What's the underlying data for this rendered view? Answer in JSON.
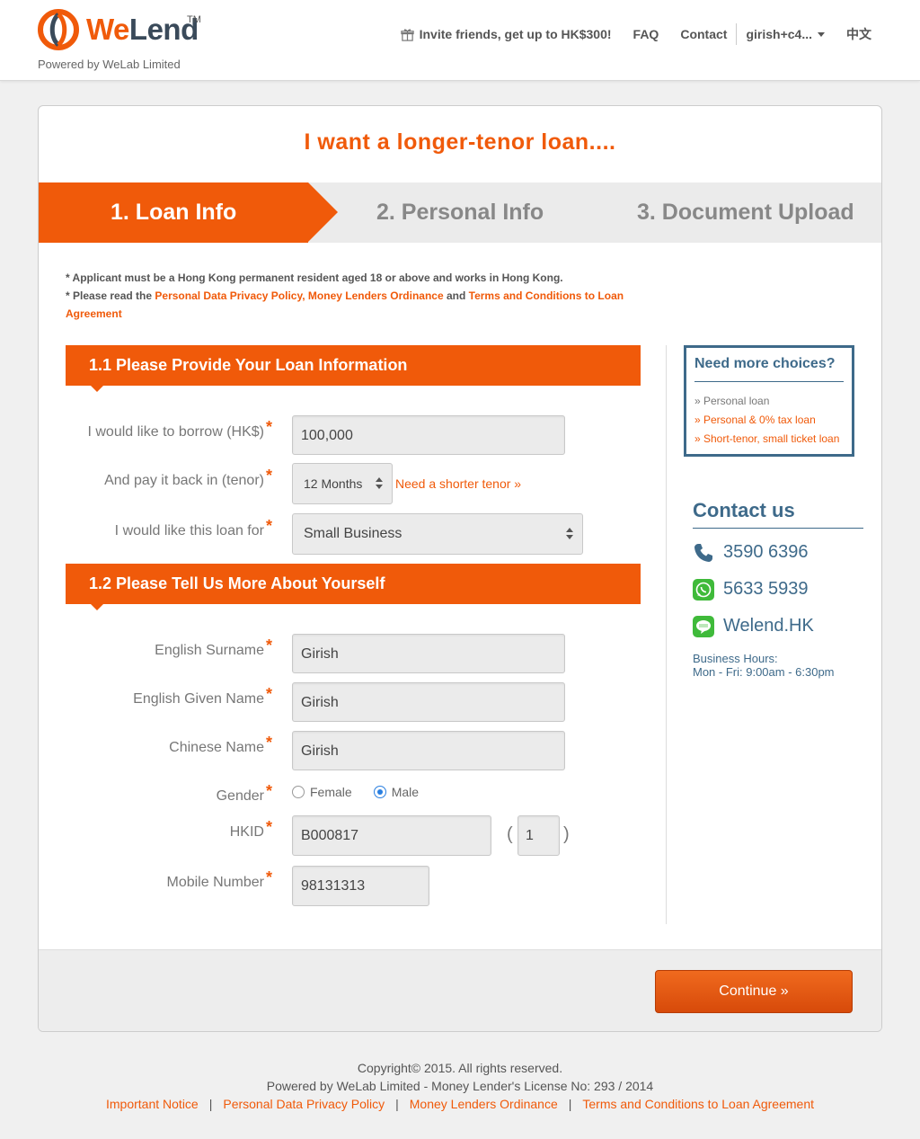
{
  "header": {
    "logo": {
      "brand_we": "We",
      "brand_lend": "Lend",
      "tm": "TM",
      "powered": "Powered by WeLab Limited"
    },
    "nav": {
      "invite": "Invite friends, get up to HK$300!",
      "faq": "FAQ",
      "contact": "Contact",
      "user": "girish+c4...",
      "language": "中文"
    }
  },
  "page": {
    "title": "I want a longer-tenor loan....",
    "steps": [
      "1. Loan Info",
      "2. Personal Info",
      "3. Document Upload"
    ],
    "notes": {
      "line1": "* Applicant must be a Hong Kong permanent resident aged 18 or above and works in Hong Kong.",
      "line2_prefix": "* Please read the ",
      "privacy_link": "Personal Data Privacy Policy, Money Lenders Ordinance",
      "and": " and ",
      "terms_link": "Terms and Conditions to Loan Agreement"
    }
  },
  "section1": {
    "title": "1.1 Please Provide Your Loan Information",
    "borrow_label": "I would like to borrow (HK$)",
    "borrow_value": "100,000",
    "tenor_label": "And pay it back in (tenor)",
    "tenor_value": "12 Months",
    "shorter_link": "Need a shorter tenor »",
    "purpose_label": "I would like this loan for",
    "purpose_value": "Small Business"
  },
  "section2": {
    "title": "1.2 Please Tell Us More About Yourself",
    "surname_label": "English Surname",
    "surname_value": "Girish",
    "given_label": "English Given Name",
    "given_value": "Girish",
    "chinese_label": "Chinese Name",
    "chinese_value": "Girish",
    "gender_label": "Gender",
    "gender_options": [
      "Female",
      "Male"
    ],
    "gender_selected": "Male",
    "hkid_label": "HKID",
    "hkid_value": "B000817",
    "hkid_check": "1",
    "paren_open": "(",
    "paren_close": ")",
    "mobile_label": "Mobile Number",
    "mobile_value": "98131313",
    "required_mark": "*"
  },
  "sidebar": {
    "choices_title": "Need more choices?",
    "choices": [
      "» Personal loan",
      "» Personal & 0% tax loan",
      "» Short-tenor, small ticket loan"
    ],
    "contact_title": "Contact us",
    "phone": "3590 6396",
    "whatsapp": "5633 5939",
    "line": "Welend.HK",
    "hours_label": "Business Hours:",
    "hours_value": "Mon - Fri: 9:00am - 6:30pm"
  },
  "actions": {
    "continue": "Continue  »"
  },
  "footer": {
    "copyright": "Copyright© 2015. All rights reserved.",
    "powered": "Powered by WeLab Limited - Money Lender's License No: 293 / 2014",
    "links": [
      "Important Notice",
      "Personal Data Privacy Policy",
      "Money Lenders Ordinance",
      "Terms and Conditions to Loan Agreement"
    ],
    "separator": "|"
  },
  "colors": {
    "accent": "#f05a0a",
    "navy": "#3e6a8a",
    "radio": "#2a7fe0"
  }
}
